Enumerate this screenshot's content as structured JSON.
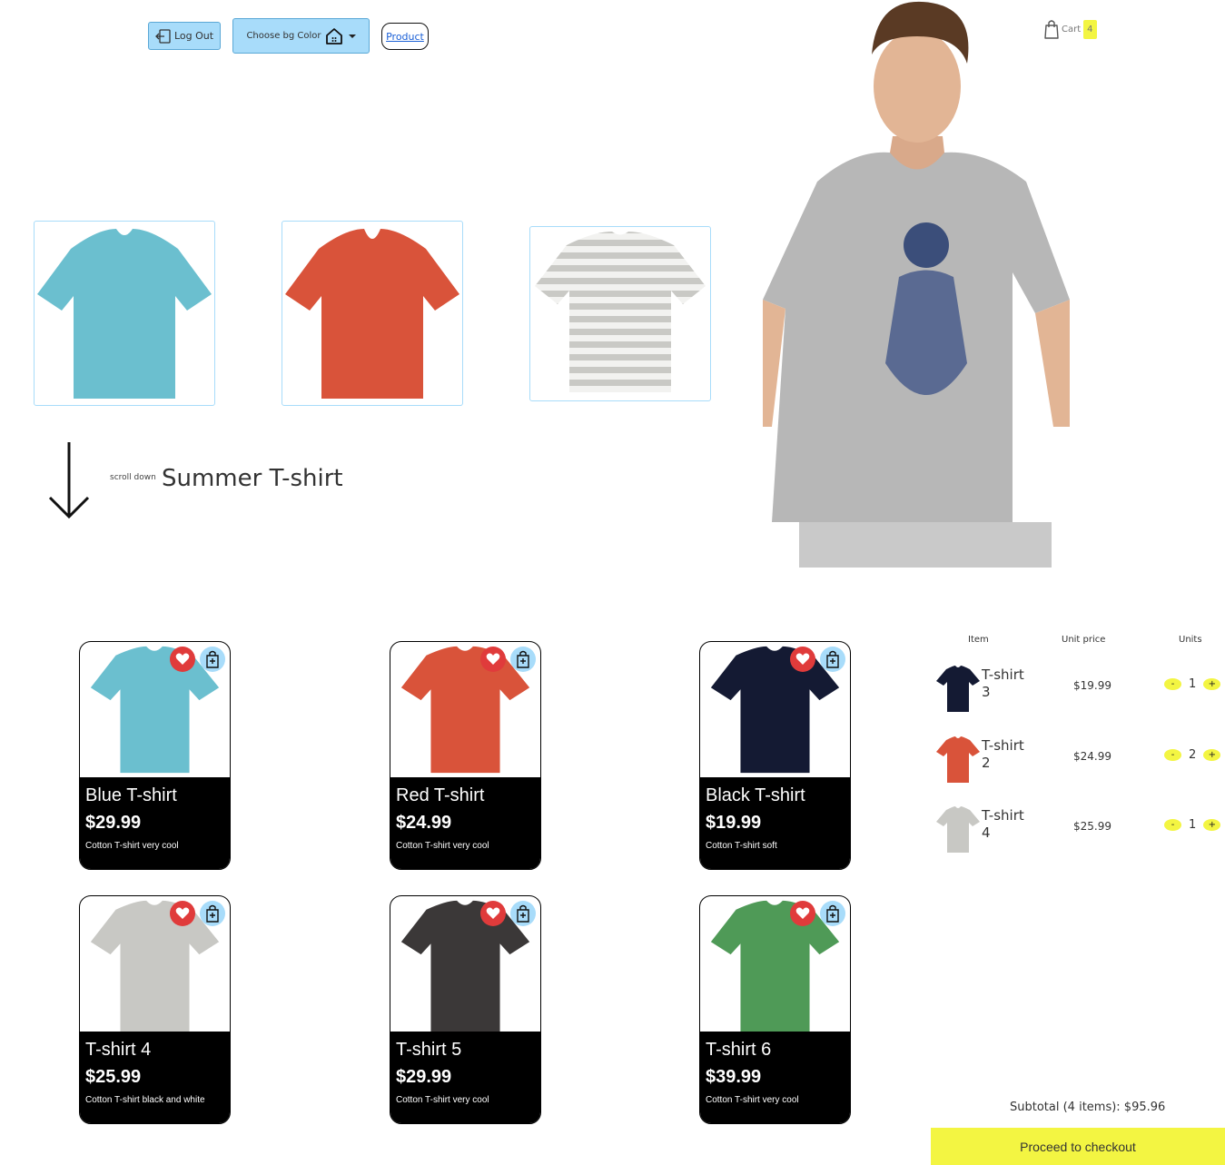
{
  "header": {
    "logout_label": "Log Out",
    "color_label": "Choose bg Color",
    "product_label": "Product",
    "cart_label": "Cart",
    "cart_count": "4"
  },
  "hero": {
    "scroll_label": "scroll down",
    "title": "Summer T-shirt",
    "thumbnails": [
      "blue",
      "red",
      "striped"
    ]
  },
  "products": [
    {
      "name": "Blue T-shirt",
      "price": "$29.99",
      "desc": "Cotton T-shirt very cool",
      "color": "#6bbfcf"
    },
    {
      "name": "Red T-shirt",
      "price": "$24.99",
      "desc": "Cotton T-shirt very cool",
      "color": "#d9533a"
    },
    {
      "name": "Black T-shirt",
      "price": "$19.99",
      "desc": "Cotton T-shirt soft",
      "color": "#141a33"
    },
    {
      "name": "T-shirt 4",
      "price": "$25.99",
      "desc": "Cotton T-shirt black and white",
      "color": "#c8c8c4"
    },
    {
      "name": "T-shirt 5",
      "price": "$29.99",
      "desc": "Cotton T-shirt very cool",
      "color": "#3b3838"
    },
    {
      "name": "T-shirt 6",
      "price": "$39.99",
      "desc": "Cotton T-shirt very cool",
      "color": "#4f9a57"
    }
  ],
  "cart": {
    "headers": {
      "item": "Item",
      "unit_price": "Unit price",
      "units": "Units"
    },
    "rows": [
      {
        "name": "T-shirt 3",
        "price": "$19.99",
        "qty": "1",
        "color": "#141a33"
      },
      {
        "name": "T-shirt 2",
        "price": "$24.99",
        "qty": "2",
        "color": "#d9533a"
      },
      {
        "name": "T-shirt 4",
        "price": "$25.99",
        "qty": "1",
        "color": "#c8c8c4"
      }
    ],
    "minus": "-",
    "plus": "+",
    "subtotal": "Subtotal (4 items): $95.96",
    "checkout_label": "Proceed to checkout"
  },
  "colors": {
    "accent_blue": "#a8dcfa",
    "accent_yellow": "#f3f542",
    "favorite_red": "#e03b3b"
  }
}
